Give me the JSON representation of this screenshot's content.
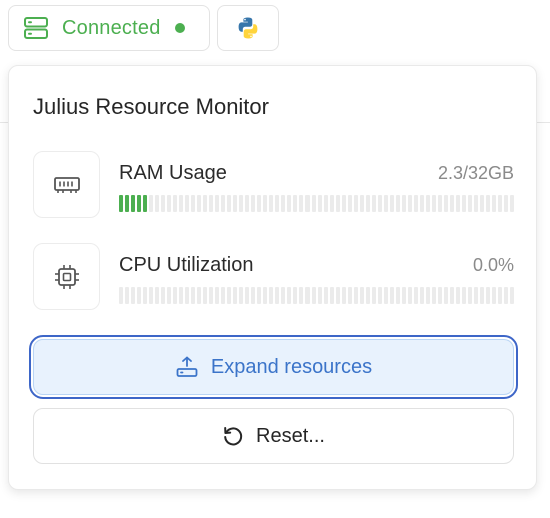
{
  "topbar": {
    "connection_status": "Connected",
    "status_color": "#4caf50",
    "kernel_icon": "python-icon",
    "server_icon": "server-icon"
  },
  "panel": {
    "title": "Julius Resource Monitor",
    "resources": [
      {
        "label": "RAM Usage",
        "value": "2.3/32GB",
        "icon": "memory-icon",
        "usage_fraction": 0.072
      },
      {
        "label": "CPU Utilization",
        "value": "0.0%",
        "icon": "cpu-icon",
        "usage_fraction": 0.0
      }
    ],
    "expand_label": "Expand resources",
    "expand_icon": "upload-icon",
    "reset_label": "Reset...",
    "reset_icon": "reset-icon"
  },
  "colors": {
    "accent": "#3b74c9",
    "usage_fill": "#4caf50",
    "track": "#ebebeb"
  }
}
